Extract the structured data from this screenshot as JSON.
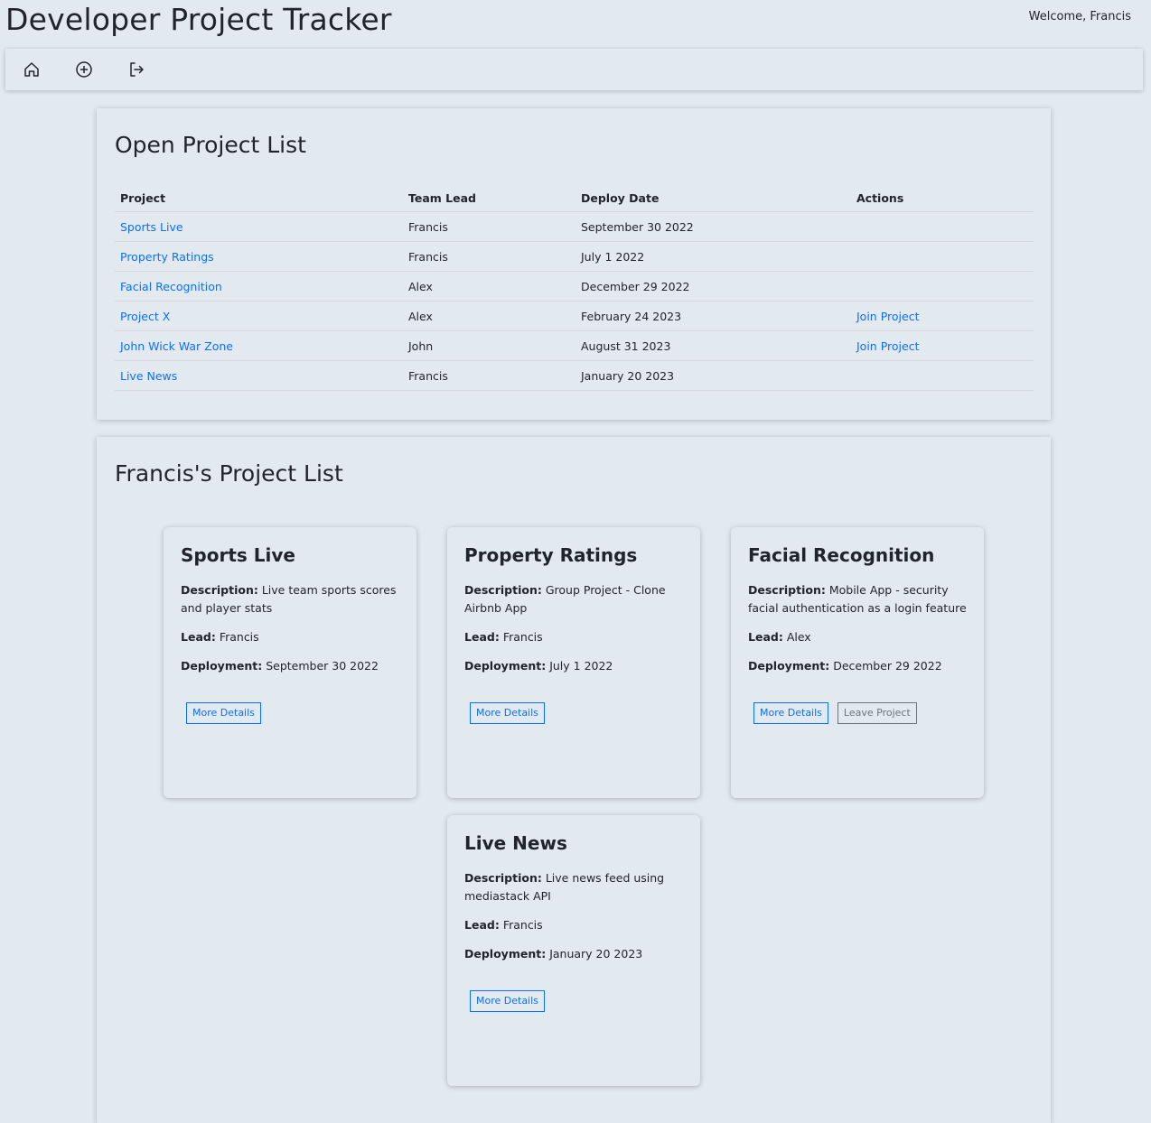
{
  "header": {
    "title": "Developer Project Tracker",
    "welcome": "Welcome, Francis"
  },
  "nav": {
    "icons": [
      "home-icon",
      "add-circle-icon",
      "logout-icon"
    ]
  },
  "open_projects": {
    "title": "Open Project List",
    "columns": [
      "Project",
      "Team Lead",
      "Deploy Date",
      "Actions"
    ],
    "rows": [
      {
        "project": "Sports Live",
        "lead": "Francis",
        "date": "September 30 2022",
        "action": ""
      },
      {
        "project": "Property Ratings",
        "lead": "Francis",
        "date": "July 1 2022",
        "action": ""
      },
      {
        "project": "Facial Recognition",
        "lead": "Alex",
        "date": "December 29 2022",
        "action": ""
      },
      {
        "project": "Project X",
        "lead": "Alex",
        "date": "February 24 2023",
        "action": "Join Project"
      },
      {
        "project": "John Wick War Zone",
        "lead": "John",
        "date": "August 31 2023",
        "action": "Join Project"
      },
      {
        "project": "Live News",
        "lead": "Francis",
        "date": "January 20 2023",
        "action": ""
      }
    ]
  },
  "my_projects": {
    "title": "Francis's Project List",
    "labels": {
      "description": "Description:",
      "lead": "Lead:",
      "deployment": "Deployment:"
    },
    "cards": [
      {
        "title": "Sports Live",
        "description": "Live team sports scores and player stats",
        "lead": "Francis",
        "deployment": "September 30 2022",
        "more_details": "More Details",
        "leave": ""
      },
      {
        "title": "Property Ratings",
        "description": "Group Project - Clone Airbnb App",
        "lead": "Francis",
        "deployment": "July 1 2022",
        "more_details": "More Details",
        "leave": ""
      },
      {
        "title": "Facial Recognition",
        "description": "Mobile App - security facial authentication as a login feature",
        "lead": "Alex",
        "deployment": "December 29 2022",
        "more_details": "More Details",
        "leave": "Leave Project"
      },
      {
        "title": "Live News",
        "description": "Live news feed using mediastack API",
        "lead": "Francis",
        "deployment": "January 20 2023",
        "more_details": "More Details",
        "leave": ""
      }
    ]
  },
  "colors": {
    "background": "#e2eaf0",
    "link": "#0d6efd",
    "secondary": "#6c757d"
  }
}
